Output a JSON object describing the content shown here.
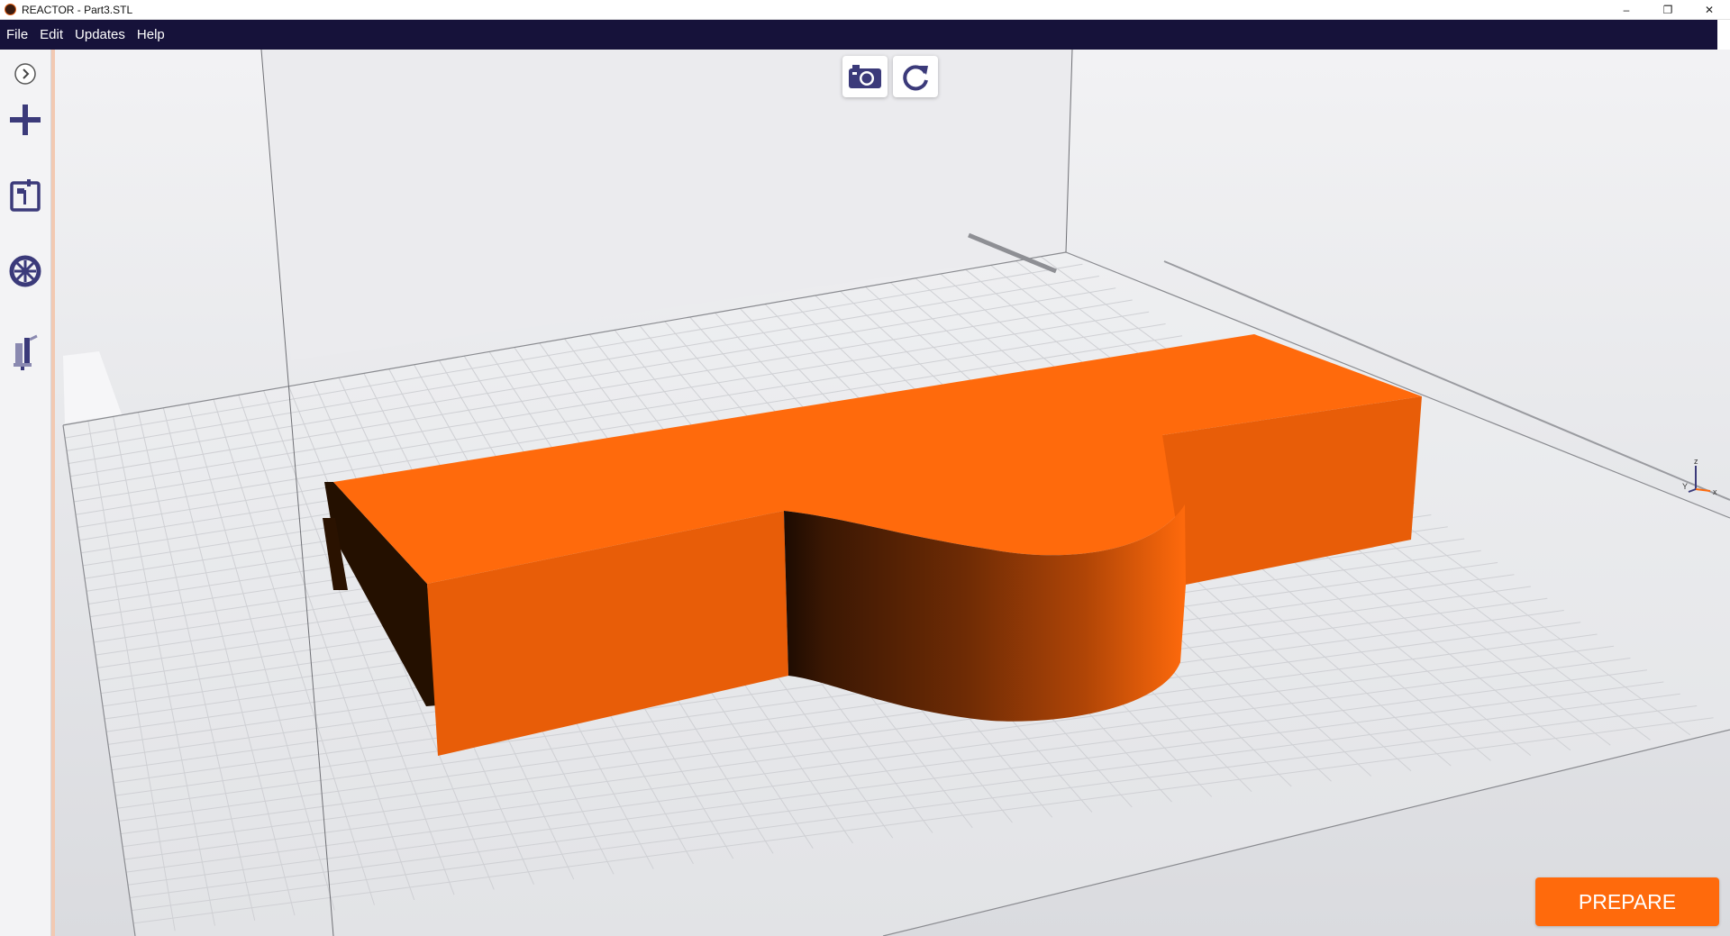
{
  "window": {
    "title": "REACTOR - Part3.STL",
    "controls": {
      "minimize": "–",
      "restore": "❐",
      "close": "✕"
    }
  },
  "menu": {
    "items": [
      {
        "label": "File"
      },
      {
        "label": "Edit"
      },
      {
        "label": "Updates"
      },
      {
        "label": "Help"
      }
    ]
  },
  "sidebar": {
    "buttons": [
      {
        "name": "expand",
        "icon": "chevron-right-icon"
      },
      {
        "name": "add-model",
        "icon": "plus-icon"
      },
      {
        "name": "printer",
        "icon": "printer-icon"
      },
      {
        "name": "material",
        "icon": "filament-spool-icon"
      },
      {
        "name": "tools",
        "icon": "nozzle-icon"
      }
    ]
  },
  "viewport": {
    "toolbar": [
      {
        "name": "snapshot",
        "icon": "camera-icon"
      },
      {
        "name": "reset-view",
        "icon": "rotate-icon"
      }
    ],
    "axis_labels": {
      "z": "z",
      "y": "Y",
      "x": "x"
    },
    "model_color": "#ff6a0c"
  },
  "actions": {
    "prepare_label": "PREPARE"
  },
  "colors": {
    "accent": "#ff6a0c",
    "menubar": "#16123a",
    "icon": "#3b3a7a"
  }
}
